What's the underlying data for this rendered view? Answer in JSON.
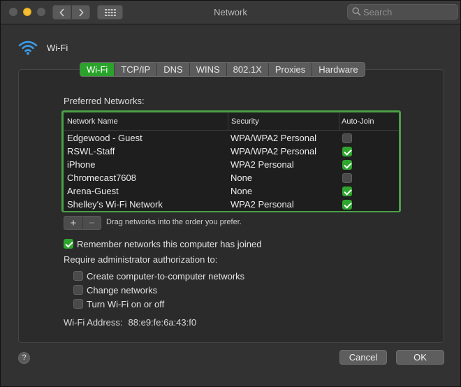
{
  "window": {
    "title": "Network",
    "search_placeholder": "Search"
  },
  "header": {
    "label": "Wi-Fi",
    "icon": "wifi-icon",
    "icon_color": "#3b9be6"
  },
  "tabs": [
    {
      "label": "Wi-Fi",
      "active": true
    },
    {
      "label": "TCP/IP",
      "active": false
    },
    {
      "label": "DNS",
      "active": false
    },
    {
      "label": "WINS",
      "active": false
    },
    {
      "label": "802.1X",
      "active": false
    },
    {
      "label": "Proxies",
      "active": false
    },
    {
      "label": "Hardware",
      "active": false
    }
  ],
  "preferred_networks": {
    "label": "Preferred Networks:",
    "columns": {
      "name": "Network Name",
      "security": "Security",
      "auto_join": "Auto-Join"
    },
    "rows": [
      {
        "name": "Edgewood - Guest",
        "security": "WPA/WPA2 Personal",
        "auto_join": false
      },
      {
        "name": "RSWL-Staff",
        "security": "WPA/WPA2 Personal",
        "auto_join": true
      },
      {
        "name": "iPhone",
        "security": "WPA2 Personal",
        "auto_join": true
      },
      {
        "name": "Chromecast7608",
        "security": "None",
        "auto_join": false
      },
      {
        "name": "Arena-Guest",
        "security": "None",
        "auto_join": true
      },
      {
        "name": "Shelley's Wi-Fi Network",
        "security": "WPA2 Personal",
        "auto_join": true
      }
    ],
    "add_label": "+",
    "remove_label": "−",
    "drag_hint": "Drag networks into the order you prefer."
  },
  "options": {
    "remember": {
      "label": "Remember networks this computer has joined",
      "checked": true
    },
    "require_label": "Require administrator authorization to:",
    "admin_items": [
      {
        "label": "Create computer-to-computer networks",
        "checked": false
      },
      {
        "label": "Change networks",
        "checked": false
      },
      {
        "label": "Turn Wi-Fi on or off",
        "checked": false
      }
    ]
  },
  "wifi_address": {
    "label": "Wi-Fi Address:",
    "value": "88:e9:fe:6a:43:f0"
  },
  "footer": {
    "help_label": "?",
    "cancel_label": "Cancel",
    "ok_label": "OK"
  },
  "colors": {
    "accent": "#2fa52f",
    "table_border": "#4aa046"
  }
}
